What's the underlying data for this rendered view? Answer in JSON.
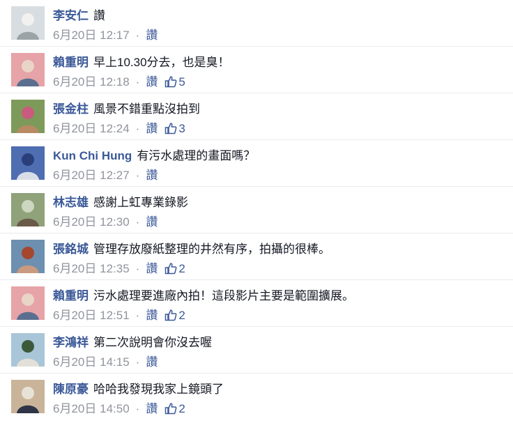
{
  "like_label": "讚",
  "colors": {
    "link": "#3b5998",
    "meta": "#90949c",
    "text": "#141823",
    "divider": "#e9ebee"
  },
  "comments": [
    {
      "name": "李安仁",
      "text": "讚",
      "date": "6月20日",
      "time": "12:17",
      "likes": null,
      "avatar": [
        "#d7dde0",
        "#9ba3a6",
        "#f3f1ef"
      ]
    },
    {
      "name": "賴重明",
      "text": "早上10.30分去，也是臭！",
      "date": "6月20日",
      "time": "12:18",
      "likes": "5",
      "avatar": [
        "#e6a3a8",
        "#5a6f8f",
        "#e9d4c8"
      ]
    },
    {
      "name": "張金柱",
      "text": "風景不錯重點沒拍到",
      "date": "6月20日",
      "time": "12:24",
      "likes": "3",
      "avatar": [
        "#7e9a5a",
        "#b78a64",
        "#c95b7e"
      ]
    },
    {
      "name": "Kun Chi Hung",
      "text": "有污水處理的畫面嗎？",
      "date": "6月20日",
      "time": "12:27",
      "likes": null,
      "avatar": [
        "#4f6db1",
        "#d9dee6",
        "#2a3f7a"
      ]
    },
    {
      "name": "林志雄",
      "text": "感謝上虹專業錄影",
      "date": "6月20日",
      "time": "12:30",
      "likes": null,
      "avatar": [
        "#8fa27a",
        "#6a5a48",
        "#cdd6c0"
      ]
    },
    {
      "name": "張銘城",
      "text": "管理存放廢紙整理的井然有序，拍攝的很棒。",
      "date": "6月20日",
      "time": "12:35",
      "likes": "2",
      "avatar": [
        "#6d8fb0",
        "#c89a80",
        "#a4472d"
      ]
    },
    {
      "name": "賴重明",
      "text": "污水處理要進廠內拍！這段影片主要是範圍擴展。",
      "date": "6月20日",
      "time": "12:51",
      "likes": "2",
      "avatar": [
        "#e6a3a8",
        "#5a6f8f",
        "#e9d4c8"
      ]
    },
    {
      "name": "李鴻祥",
      "text": "第二次說明會你沒去喔",
      "date": "6月20日",
      "time": "14:15",
      "likes": null,
      "avatar": [
        "#a9c6d9",
        "#e3e0d8",
        "#3c5a3a"
      ]
    },
    {
      "name": "陳原豪",
      "text": "哈哈我發現我家上鏡頭了",
      "date": "6月20日",
      "time": "14:50",
      "likes": "2",
      "avatar": [
        "#c9b49a",
        "#2f3547",
        "#e8e2d6"
      ]
    }
  ]
}
